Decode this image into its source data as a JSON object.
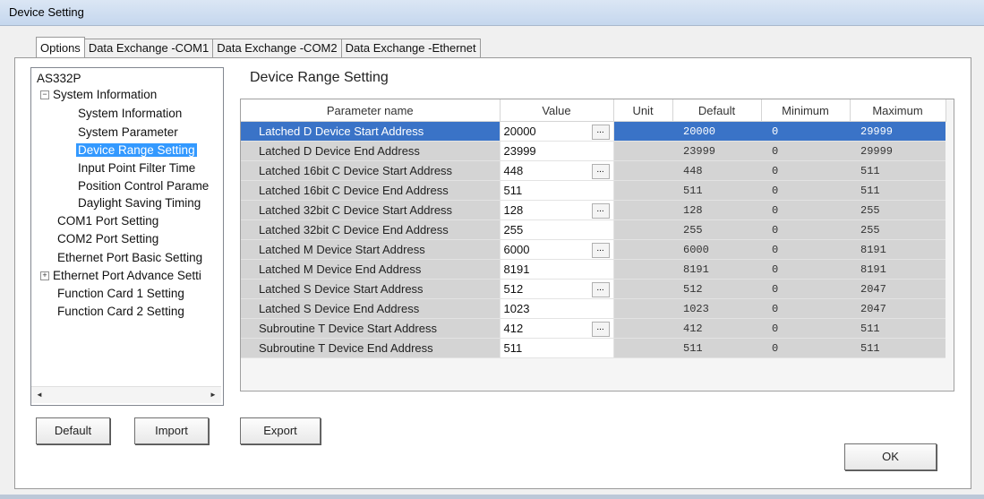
{
  "window": {
    "title": "Device Setting"
  },
  "tabs": [
    {
      "label": "Options",
      "active": true
    },
    {
      "label": "Data Exchange -COM1",
      "active": false
    },
    {
      "label": "Data Exchange -COM2",
      "active": false
    },
    {
      "label": "Data Exchange -Ethernet",
      "active": false
    }
  ],
  "tree": {
    "root": "AS332P",
    "items": [
      {
        "label": "System Information",
        "expander": "−"
      },
      {
        "label": "System Information"
      },
      {
        "label": "System Parameter"
      },
      {
        "label": "Device Range Setting",
        "selected": true
      },
      {
        "label": "Input Point Filter Time"
      },
      {
        "label": "Position Control Parame"
      },
      {
        "label": "Daylight Saving Timing"
      },
      {
        "label": "COM1 Port Setting"
      },
      {
        "label": "COM2 Port Setting"
      },
      {
        "label": "Ethernet Port Basic Setting"
      },
      {
        "label": "Ethernet Port Advance Setti",
        "expander": "+"
      },
      {
        "label": "Function Card 1 Setting"
      },
      {
        "label": "Function Card 2 Setting"
      }
    ]
  },
  "main": {
    "heading": "Device Range Setting"
  },
  "table": {
    "columns": [
      "Parameter name",
      "Value",
      "Unit",
      "Default",
      "Minimum",
      "Maximum"
    ],
    "rows": [
      {
        "name": "Latched D Device Start Address",
        "value": "20000",
        "unit": "",
        "default": "20000",
        "min": "0",
        "max": "29999",
        "dots": true,
        "selected": true
      },
      {
        "name": "Latched D Device End Address",
        "value": "23999",
        "unit": "",
        "default": "23999",
        "min": "0",
        "max": "29999",
        "dots": false
      },
      {
        "name": "Latched 16bit C Device Start Address",
        "value": "448",
        "unit": "",
        "default": "448",
        "min": "0",
        "max": "511",
        "dots": true
      },
      {
        "name": "Latched 16bit C Device End Address",
        "value": "511",
        "unit": "",
        "default": "511",
        "min": "0",
        "max": "511",
        "dots": false
      },
      {
        "name": "Latched 32bit C Device Start Address",
        "value": "128",
        "unit": "",
        "default": "128",
        "min": "0",
        "max": "255",
        "dots": true
      },
      {
        "name": "Latched 32bit C Device End Address",
        "value": "255",
        "unit": "",
        "default": "255",
        "min": "0",
        "max": "255",
        "dots": false
      },
      {
        "name": "Latched M Device Start Address",
        "value": "6000",
        "unit": "",
        "default": "6000",
        "min": "0",
        "max": "8191",
        "dots": true
      },
      {
        "name": "Latched M Device End Address",
        "value": "8191",
        "unit": "",
        "default": "8191",
        "min": "0",
        "max": "8191",
        "dots": false
      },
      {
        "name": "Latched S Device Start Address",
        "value": "512",
        "unit": "",
        "default": "512",
        "min": "0",
        "max": "2047",
        "dots": true
      },
      {
        "name": "Latched S Device End Address",
        "value": "1023",
        "unit": "",
        "default": "1023",
        "min": "0",
        "max": "2047",
        "dots": false
      },
      {
        "name": "Subroutine T Device Start Address",
        "value": "412",
        "unit": "",
        "default": "412",
        "min": "0",
        "max": "511",
        "dots": true
      },
      {
        "name": "Subroutine T Device End Address",
        "value": "511",
        "unit": "",
        "default": "511",
        "min": "0",
        "max": "511",
        "dots": false
      }
    ],
    "dots_label": "..."
  },
  "buttons": {
    "default": "Default",
    "import": "Import",
    "export": "Export",
    "ok": "OK"
  },
  "icons": {
    "scroll_left": "◄",
    "scroll_right": "►"
  }
}
